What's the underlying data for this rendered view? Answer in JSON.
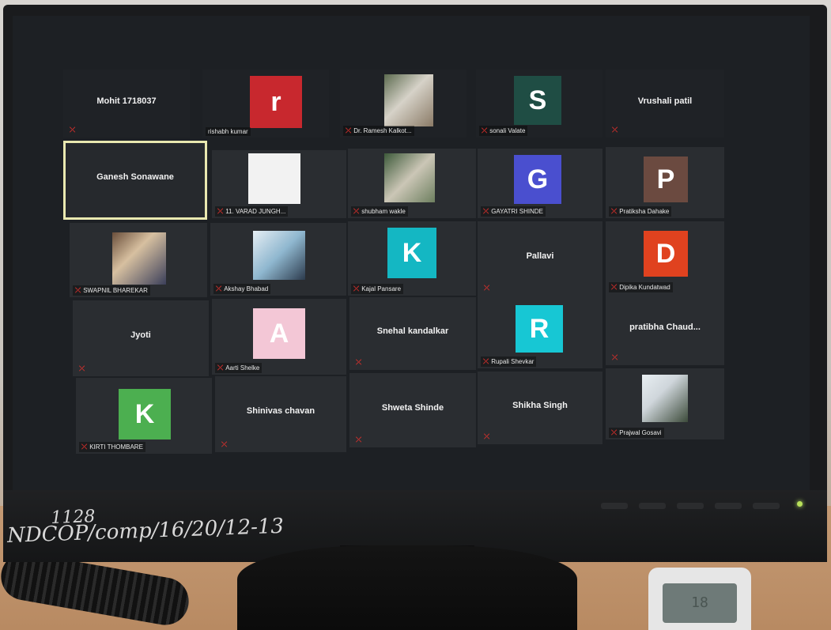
{
  "screen": {
    "raised_hand_icon": "hand-icon",
    "tiles": [
      {
        "name": "Mohit 1718037",
        "avatar": null
      },
      {
        "name": "rishabh kumar",
        "avatar": "r",
        "color": "#c8282e"
      },
      {
        "name": "Dr. Ramesh Kalkot...",
        "avatar": "photo"
      },
      {
        "name": "sonali Valate",
        "avatar": "S",
        "color": "#1f4d44"
      },
      {
        "name": "Vrushali patil",
        "avatar": null
      },
      {
        "name": "Ganesh Sonawane",
        "avatar": null,
        "active": true
      },
      {
        "name": "11. VARAD JUNGH...",
        "avatar": "blank",
        "color": "#f2f2f2"
      },
      {
        "name": "shubham wakle",
        "avatar": "photo"
      },
      {
        "name": "GAYATRI SHINDE",
        "avatar": "G",
        "color": "#4a4fcf"
      },
      {
        "name": "Pratiksha Dahake",
        "avatar": "P",
        "color": "#6b4a40"
      },
      {
        "name": "SWAPNIL BHAREKAR",
        "avatar": "photo"
      },
      {
        "name": "Akshay Bhabad",
        "avatar": "photo"
      },
      {
        "name": "Kajal Pansare",
        "avatar": "K",
        "color": "#14b7c3"
      },
      {
        "name": "Pallavi",
        "avatar": null
      },
      {
        "name": "Dipika Kundatwad",
        "avatar": "D",
        "color": "#e0421f"
      },
      {
        "name": "Jyoti",
        "avatar": null
      },
      {
        "name": "Aarti Shelke",
        "avatar": "A",
        "color": "#f3c7d6"
      },
      {
        "name": "Snehal kandalkar",
        "avatar": null
      },
      {
        "name": "Rupali Shevkar",
        "avatar": "R",
        "color": "#17c7d4"
      },
      {
        "name": "pratibha Chaud...",
        "avatar": null
      },
      {
        "name": "KIRTI THOMBARE",
        "avatar": "K",
        "color": "#4caf50"
      },
      {
        "name": "Shinivas chavan",
        "avatar": null
      },
      {
        "name": "Shweta Shinde",
        "avatar": null
      },
      {
        "name": "Shikha Singh",
        "avatar": null
      },
      {
        "name": "Prajwal Gosavi",
        "avatar": "photo"
      }
    ]
  },
  "handwriting": {
    "line1": "1128",
    "line2": "NDCOP/comp/16/20/12-13"
  },
  "meter": {
    "display": "18"
  },
  "icons": {
    "mute": "muted-mic-icon",
    "cursor": "mouse-cursor-icon"
  }
}
